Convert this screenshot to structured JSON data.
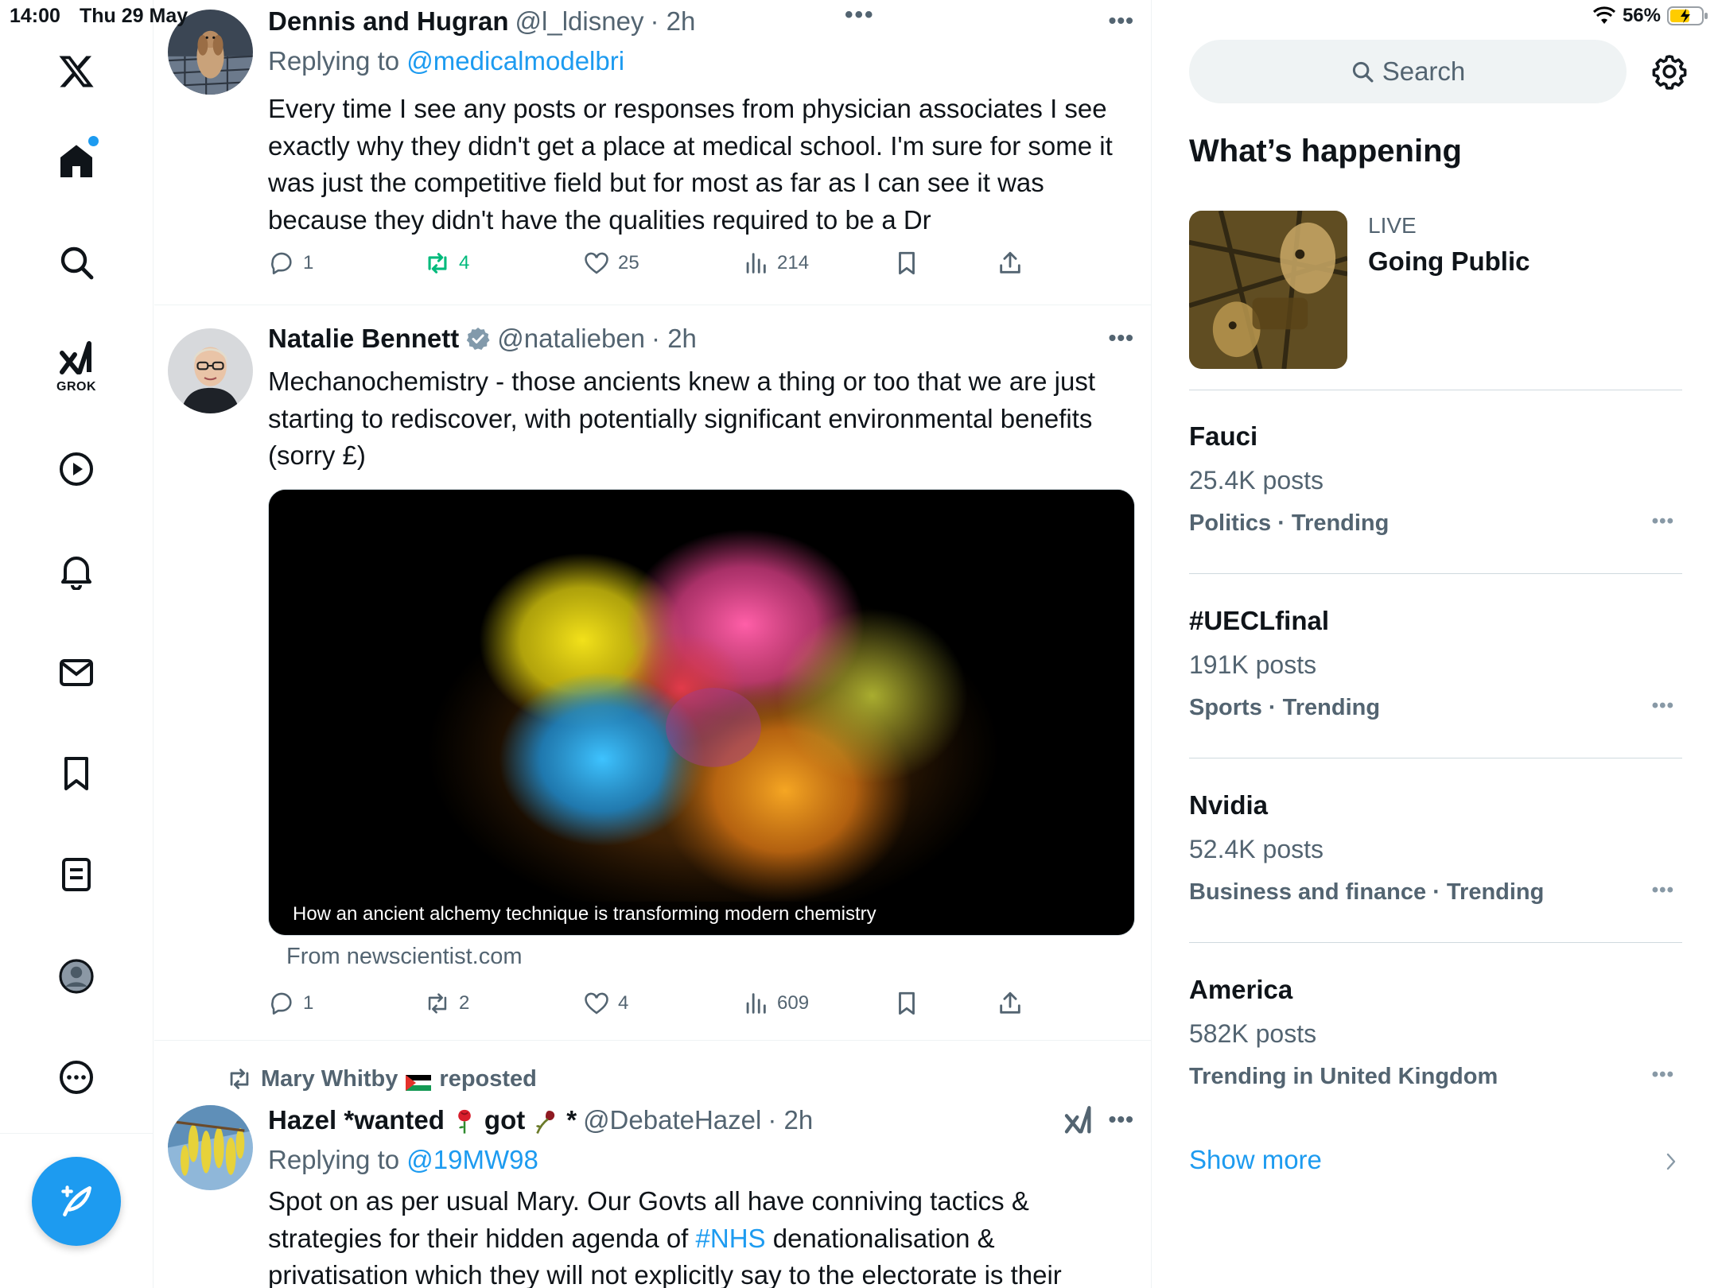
{
  "status_bar": {
    "time": "14:00",
    "date": "Thu 29 May",
    "battery": "56%"
  },
  "nav": {
    "grok_label": "GROK",
    "items": [
      "x-logo",
      "home-icon",
      "search-icon",
      "grok-icon",
      "video-icon",
      "notifications-icon",
      "messages-icon",
      "bookmarks-icon",
      "lists-icon",
      "profile-icon",
      "more-icon"
    ],
    "accent": "#1d9bf0"
  },
  "timeline": {
    "tweet1": {
      "name": "Dennis and Hugran",
      "handle": "@l_ldisney",
      "time": "· 2h",
      "replying_prefix": "Replying to",
      "replying_to": "@medicalmodelbri",
      "text": "Every time I see any posts or responses from physician associates I see exactly why they didn't get a place at medical school. I'm sure for some it was just the competitive field but for most as far as I can see it was because they didn't have the qualities required to be a Dr",
      "replies": "1",
      "reposts": "4",
      "likes": "25",
      "views": "214"
    },
    "tweet2": {
      "name": "Natalie Bennett",
      "handle": "@natalieben",
      "time": "· 2h",
      "text": "Mechanochemistry - those ancients knew a thing or too that we are just starting to rediscover, with potentially significant environmental benefits (sorry £)",
      "media_caption": "How an ancient alchemy technique is transforming modern chemistry",
      "media_from": "From newscientist.com",
      "replies": "1",
      "reposts": "2",
      "likes": "4",
      "views": "609"
    },
    "tweet3": {
      "repost_by": "Mary Whitby",
      "repost_suffix": "reposted",
      "name_part1": "Hazel *wanted",
      "name_part2": "got",
      "name_part3": "*",
      "handle": "@DebateHazel",
      "time": "· 2h",
      "replying_prefix": "Replying to",
      "replying_to": "@19MW98",
      "text_before": "Spot on as per usual Mary.  Our Govts all have conniving tactics & strategies for their hidden agenda of ",
      "hashtag": "#NHS",
      "text_after": " denationalisation & privatisation which they will not explicitly say to the electorate is their"
    }
  },
  "sidebar": {
    "search_placeholder": "Search",
    "title": "What’s happening",
    "live": {
      "label": "LIVE",
      "title": "Going Public"
    },
    "trends": [
      {
        "name": "Fauci",
        "posts": "25.4K posts",
        "category": "Politics · Trending"
      },
      {
        "name": "#UECLfinal",
        "posts": "191K posts",
        "category": "Sports · Trending"
      },
      {
        "name": "Nvidia",
        "posts": "52.4K posts",
        "category": "Business and finance · Trending"
      },
      {
        "name": "America",
        "posts": "582K posts",
        "category": "Trending in United Kingdom"
      }
    ],
    "show_more": "Show more"
  }
}
